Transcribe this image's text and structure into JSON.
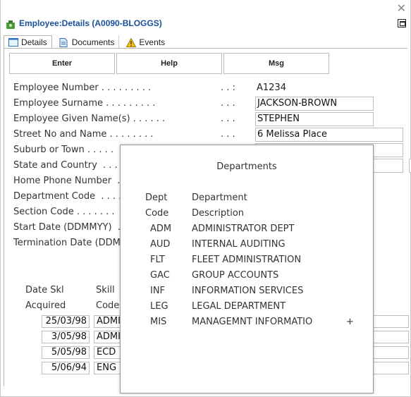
{
  "window": {
    "title": "Employee:Details (A0090-BLOGGS)",
    "close_glyph": "✕"
  },
  "tabs": [
    {
      "label": "Details",
      "icon": "details-icon"
    },
    {
      "label": "Documents",
      "icon": "document-icon"
    },
    {
      "label": "Events",
      "icon": "warning-icon"
    }
  ],
  "toolbar": {
    "enter_label": "Enter",
    "help_label": "Help",
    "msg_label": "Msg"
  },
  "form": {
    "employee_number": {
      "label": "Employee Number . . . . . . . . .",
      "colon": ". . :",
      "value": "A1234"
    },
    "surname": {
      "label": "Employee Surname . . . . . . . . .",
      "colon": ". . .",
      "value": "JACKSON-BROWN"
    },
    "given_names": {
      "label": "Employee Given Name(s) . . . . . .",
      "colon": ". . .",
      "value": "STEPHEN"
    },
    "street": {
      "label": "Street No and Name . . . . . . . .",
      "colon": ". . .",
      "value": "6 Melissa Place"
    },
    "suburb": {
      "label": "Suburb or Town . . . . .",
      "value": ""
    },
    "state": {
      "label": "State and Country  . . .",
      "value": ""
    },
    "phone": {
      "label": "Home Phone Number  .",
      "value": ""
    },
    "dept_code": {
      "label": "Department Code  . . . ."
    },
    "section_code": {
      "label": "Section Code . . . . . . ."
    },
    "start_date": {
      "label": "Start Date (DDMMYY)  ."
    },
    "termination_date": {
      "label": "Termination Date (DDM"
    }
  },
  "skills": {
    "col1_line1": "Date Skl",
    "col1_line2": "Acquired",
    "col2_line1": "Skill",
    "col2_line2": "Code",
    "rows": [
      {
        "date": "25/03/98",
        "code": "ADMI"
      },
      {
        "date": "3/05/98",
        "code": "ADMI"
      },
      {
        "date": "5/05/98",
        "code": "ECD"
      },
      {
        "date": "5/06/94",
        "code": "ENG"
      }
    ]
  },
  "popup": {
    "title": "Departments",
    "col1_line1": "Dept",
    "col1_line2": "Code",
    "col2_line1": "Department",
    "col2_line2": "Description",
    "rows": [
      {
        "code": "ADM",
        "desc": "ADMINISTRATOR DEPT"
      },
      {
        "code": "AUD",
        "desc": "INTERNAL AUDITING"
      },
      {
        "code": "FLT",
        "desc": "FLEET ADMINISTRATION"
      },
      {
        "code": "GAC",
        "desc": "GROUP ACCOUNTS"
      },
      {
        "code": "INF",
        "desc": "INFORMATION SERVICES"
      },
      {
        "code": "LEG",
        "desc": "LEGAL DEPARTMENT"
      },
      {
        "code": "MIS",
        "desc": "MANAGEMNT INFORMATIO"
      }
    ],
    "more_indicator": "+"
  }
}
